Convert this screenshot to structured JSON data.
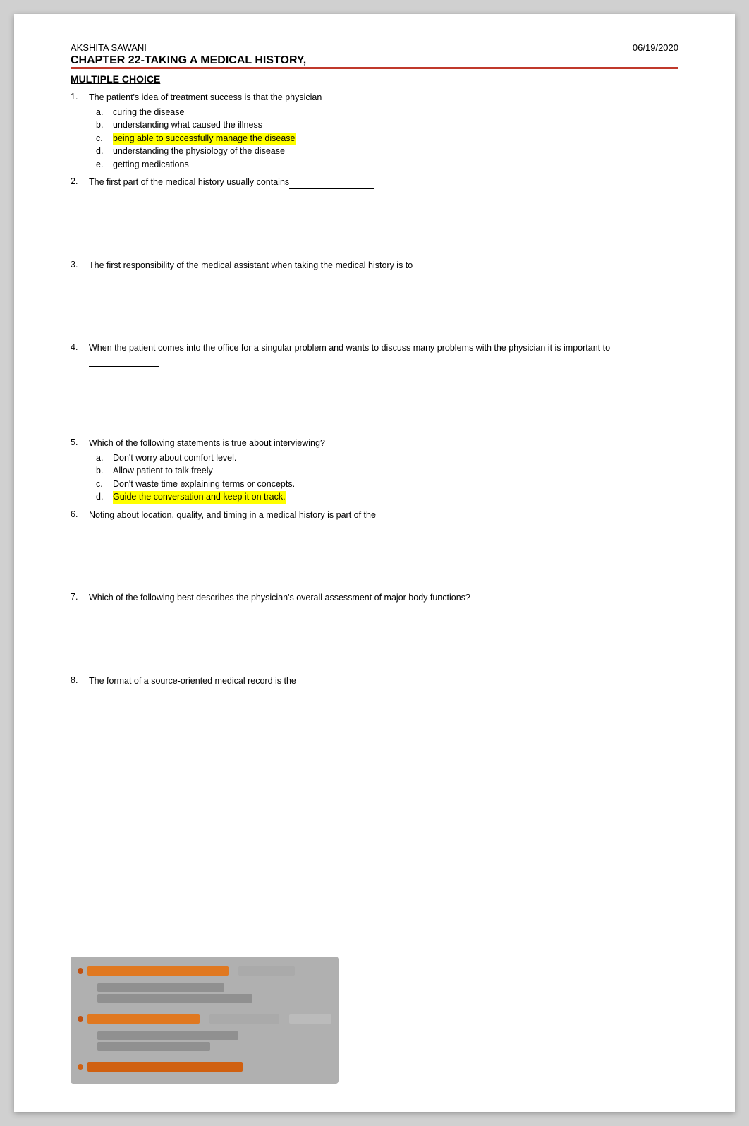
{
  "header": {
    "name": "AKSHITA SAWANI",
    "date": "06/19/2020",
    "chapter_title": "CHAPTER 22-TAKING A MEDICAL HISTORY,"
  },
  "section": {
    "title": "MULTIPLE CHOICE"
  },
  "questions": [
    {
      "number": "1.",
      "text": "The patient's idea of treatment success is that the physician",
      "answers": [
        {
          "letter": "a.",
          "text": "curing the disease",
          "highlight": false
        },
        {
          "letter": "b.",
          "text": "understanding what caused the illness",
          "highlight": false
        },
        {
          "letter": "c.",
          "text": "being able to successfully manage the disease",
          "highlight": true
        },
        {
          "letter": "d.",
          "text": "understanding the physiology of the disease",
          "highlight": false
        },
        {
          "letter": "e.",
          "text": "getting medications",
          "highlight": false
        }
      ],
      "spacing": "small"
    },
    {
      "number": "2.",
      "text": "The first part of the medical history usually contains",
      "blank": true,
      "answers": [],
      "spacing": "large"
    },
    {
      "number": "3.",
      "text": "The first responsibility of the medical assistant when taking the medical history is to",
      "blank": false,
      "answers": [],
      "spacing": "large"
    },
    {
      "number": "4.",
      "text": "When the patient comes into the office for a singular problem and wants to discuss many problems with the physician it is important to",
      "blank": true,
      "blank_short": true,
      "answers": [],
      "spacing": "large"
    },
    {
      "number": "5.",
      "text": "Which of the following statements is true about interviewing?",
      "answers": [
        {
          "letter": "a.",
          "text": "Don't worry about comfort level.",
          "highlight": false
        },
        {
          "letter": "b.",
          "text": "Allow patient to talk freely",
          "highlight": false
        },
        {
          "letter": "c.",
          "text": "Don't waste time explaining terms or concepts.",
          "highlight": false
        },
        {
          "letter": "d.",
          "text": "Guide the conversation and keep it on track.",
          "highlight": true
        }
      ],
      "spacing": "small"
    },
    {
      "number": "6.",
      "text": "Noting about location, quality, and timing in a medical history is part of the",
      "blank": true,
      "answers": [],
      "spacing": "large"
    },
    {
      "number": "7.",
      "text": "Which of the following best describes the physician's overall assessment of major body functions?",
      "answers": [],
      "spacing": "large"
    },
    {
      "number": "8.",
      "text": "The format of a source-oriented medical record is the",
      "answers": [],
      "spacing": "large"
    }
  ]
}
